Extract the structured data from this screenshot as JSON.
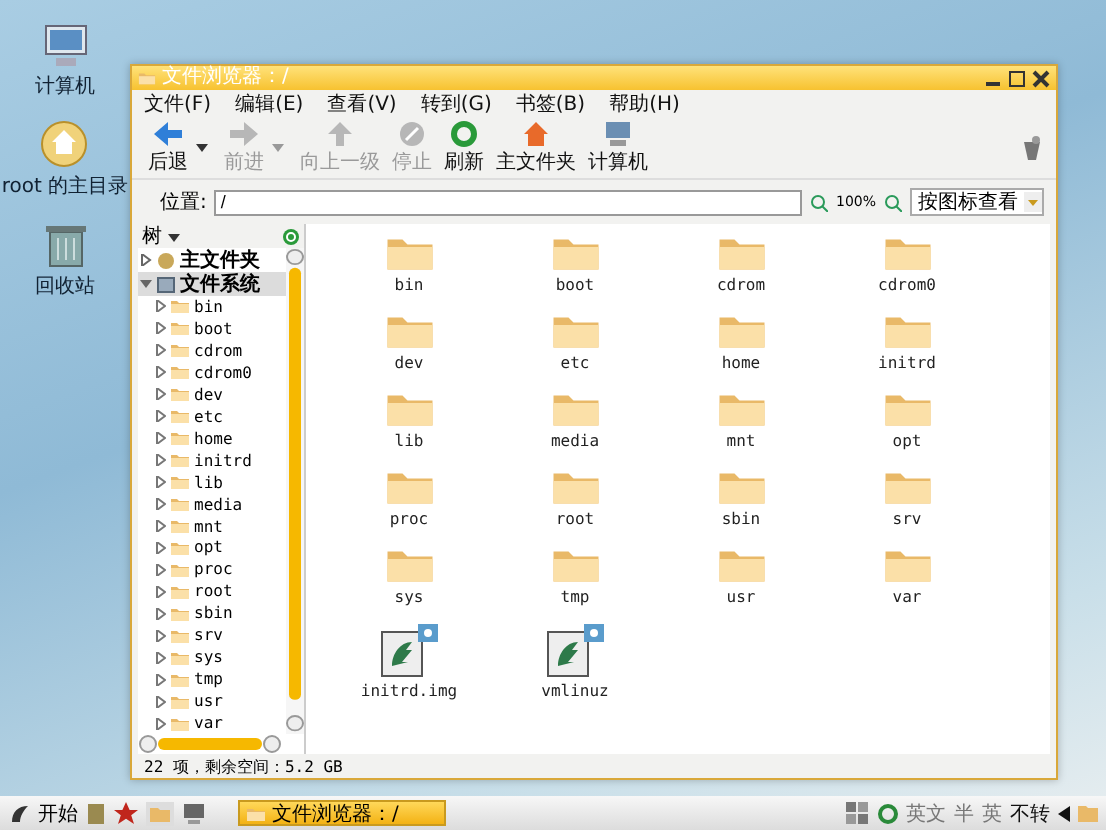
{
  "desktop_icons": [
    {
      "label": "计算机",
      "kind": "computer"
    },
    {
      "label": "root 的主目录",
      "kind": "home"
    },
    {
      "label": "回收站",
      "kind": "trash"
    }
  ],
  "window": {
    "title": "文件浏览器：/",
    "menu": [
      "文件(F)",
      "编辑(E)",
      "查看(V)",
      "转到(G)",
      "书签(B)",
      "帮助(H)"
    ],
    "toolbar": [
      {
        "label": "后退",
        "kind": "back",
        "disabled": false,
        "dropdown": true
      },
      {
        "label": "前进",
        "kind": "forward",
        "disabled": true,
        "dropdown": true
      },
      {
        "label": "向上一级",
        "kind": "up",
        "disabled": true,
        "dropdown": false
      },
      {
        "label": "停止",
        "kind": "stop",
        "disabled": true,
        "dropdown": false
      },
      {
        "label": "刷新",
        "kind": "reload",
        "disabled": false,
        "dropdown": false
      },
      {
        "label": "主文件夹",
        "kind": "home",
        "disabled": false,
        "dropdown": false
      },
      {
        "label": "计算机",
        "kind": "computer",
        "disabled": false,
        "dropdown": false
      }
    ],
    "location": {
      "label": "位置:",
      "value": "/"
    },
    "zoom": "100%",
    "view_mode": "按图标查看",
    "sidebar": {
      "title": "树",
      "items": [
        {
          "label": "主文件夹",
          "kind": "home",
          "expanded": false,
          "selected": false
        },
        {
          "label": "文件系统",
          "kind": "drive",
          "expanded": true,
          "selected": true,
          "children": [
            {
              "label": "bin"
            },
            {
              "label": "boot"
            },
            {
              "label": "cdrom"
            },
            {
              "label": "cdrom0"
            },
            {
              "label": "dev"
            },
            {
              "label": "etc"
            },
            {
              "label": "home"
            },
            {
              "label": "initrd"
            },
            {
              "label": "lib"
            },
            {
              "label": "media"
            },
            {
              "label": "mnt"
            },
            {
              "label": "opt"
            },
            {
              "label": "proc"
            },
            {
              "label": "root"
            },
            {
              "label": "sbin"
            },
            {
              "label": "srv"
            },
            {
              "label": "sys"
            },
            {
              "label": "tmp"
            },
            {
              "label": "usr"
            },
            {
              "label": "var"
            }
          ]
        }
      ]
    },
    "files": [
      {
        "name": "bin",
        "kind": "folder"
      },
      {
        "name": "boot",
        "kind": "folder"
      },
      {
        "name": "cdrom",
        "kind": "folder"
      },
      {
        "name": "cdrom0",
        "kind": "folder"
      },
      {
        "name": "dev",
        "kind": "folder"
      },
      {
        "name": "etc",
        "kind": "folder"
      },
      {
        "name": "home",
        "kind": "folder"
      },
      {
        "name": "initrd",
        "kind": "folder"
      },
      {
        "name": "lib",
        "kind": "folder"
      },
      {
        "name": "media",
        "kind": "folder"
      },
      {
        "name": "mnt",
        "kind": "folder"
      },
      {
        "name": "opt",
        "kind": "folder"
      },
      {
        "name": "proc",
        "kind": "folder"
      },
      {
        "name": "root",
        "kind": "folder"
      },
      {
        "name": "sbin",
        "kind": "folder"
      },
      {
        "name": "srv",
        "kind": "folder"
      },
      {
        "name": "sys",
        "kind": "folder"
      },
      {
        "name": "tmp",
        "kind": "folder"
      },
      {
        "name": "usr",
        "kind": "folder"
      },
      {
        "name": "var",
        "kind": "folder"
      },
      {
        "name": "initrd.img",
        "kind": "link"
      },
      {
        "name": "vmlinuz",
        "kind": "link"
      }
    ],
    "status_bar": "22 项，剩余空间：5.2 GB"
  },
  "taskbar": {
    "start": "开始",
    "tasks": [
      {
        "label": "文件浏览器：/",
        "selected": true
      }
    ],
    "tray": [
      "英文",
      "半",
      "英",
      "不转"
    ]
  }
}
